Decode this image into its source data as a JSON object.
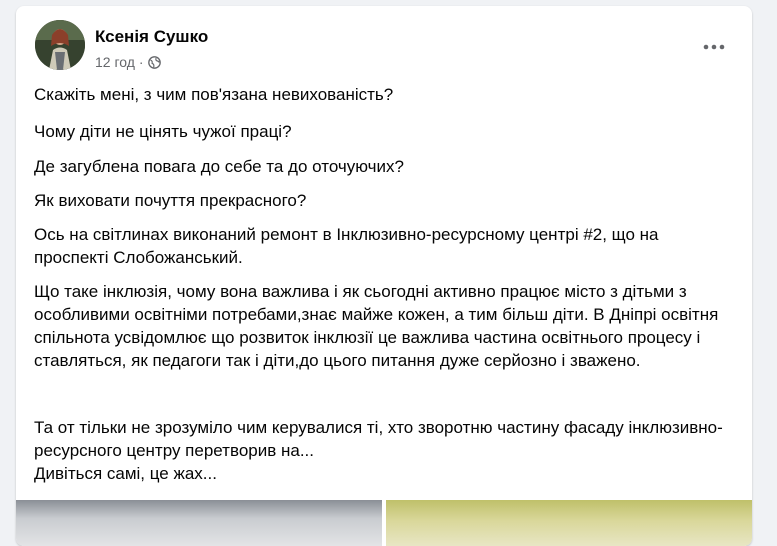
{
  "post": {
    "author": "Ксенія Сушко",
    "time": "12 год",
    "separator": "·",
    "audience_icon": "globe-icon",
    "more_icon": "more-dots-icon",
    "paragraphs": [
      "Скажіть мені, з чим пов'язана невихованість?",
      "Чому діти не цінять чужої праці?",
      "Де загублена повага до себе та до оточуючих?",
      "Як виховати почуття прекрасного?",
      "Ось на світлинах виконаний ремонт в Інклюзивно-ресурсному центрі #2, що на проспекті Слобожанський.",
      "Що таке інклюзія, чому вона важлива і як сьогодні активно працює місто з дітьми з особливими освітніми потребами,знає майже кожен, а тим більш діти. В Дніпрі освітня  спільнота  усвідомлює що розвиток інклюзії це важлива частина освітнього процесу і ставляться, як педагоги так і діти,до цього питання дуже серйозно і зважено.",
      "Та от тільки не зрозуміло чим керувалися ті, хто зворотню частину фасаду інклюзивно-ресурсного центру перетворив на...\nДивіться самі, це жах..."
    ]
  },
  "colors": {
    "background": "#f0f2f5",
    "card": "#ffffff",
    "text_primary": "#050505",
    "text_secondary": "#65676b"
  }
}
